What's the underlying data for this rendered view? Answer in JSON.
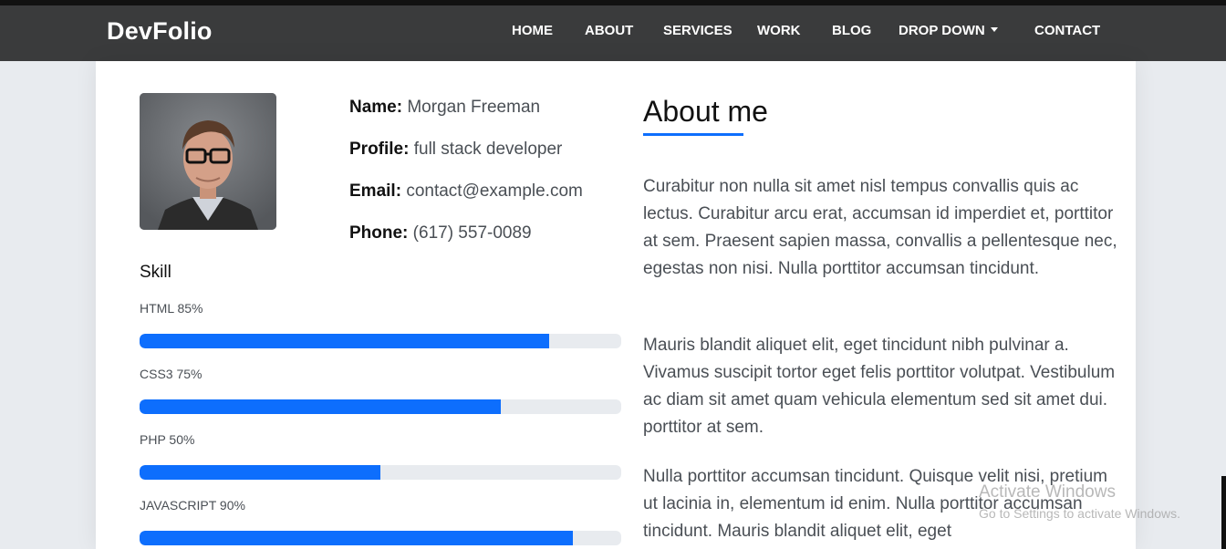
{
  "brand": "DevFolio",
  "nav": {
    "home": "HOME",
    "about": "ABOUT",
    "services": "SERVICES",
    "work": "WORK",
    "blog": "BLOG",
    "dropdown": "DROP DOWN",
    "contact": "CONTACT"
  },
  "profile": {
    "name_label": "Name:",
    "name": "Morgan Freeman",
    "profile_label": "Profile:",
    "profile": "full stack developer",
    "email_label": "Email:",
    "email": "contact@example.com",
    "phone_label": "Phone:",
    "phone": "(617) 557-0089"
  },
  "skills": {
    "title": "Skill",
    "items": [
      {
        "label": "HTML 85%",
        "value": 85
      },
      {
        "label": "CSS3 75%",
        "value": 75
      },
      {
        "label": "PHP 50%",
        "value": 50
      },
      {
        "label": "JAVASCRIPT 90%",
        "value": 90
      }
    ]
  },
  "about": {
    "title": "About me",
    "paragraphs": [
      "Curabitur non nulla sit amet nisl tempus convallis quis ac lectus. Curabitur arcu erat, accumsan id imperdiet et, porttitor at sem. Praesent sapien massa, convallis a pellentesque nec, egestas non nisi. Nulla porttitor accumsan tincidunt.",
      "Mauris blandit aliquet elit, eget tincidunt nibh pulvinar a. Vivamus suscipit tortor eget felis porttitor volutpat. Vestibulum ac diam sit amet quam vehicula elementum sed sit amet dui. porttitor at sem.",
      "Nulla porttitor accumsan tincidunt. Quisque velit nisi, pretium ut lacinia in, elementum id enim. Nulla porttitor accumsan tincidunt. Mauris blandit aliquet elit, eget"
    ]
  },
  "watermark": {
    "title": "Activate Windows",
    "subtitle": "Go to Settings to activate Windows."
  },
  "colors": {
    "accent": "#0d6efd",
    "navbar": "#3a3b3c",
    "track": "#e8ebef"
  }
}
